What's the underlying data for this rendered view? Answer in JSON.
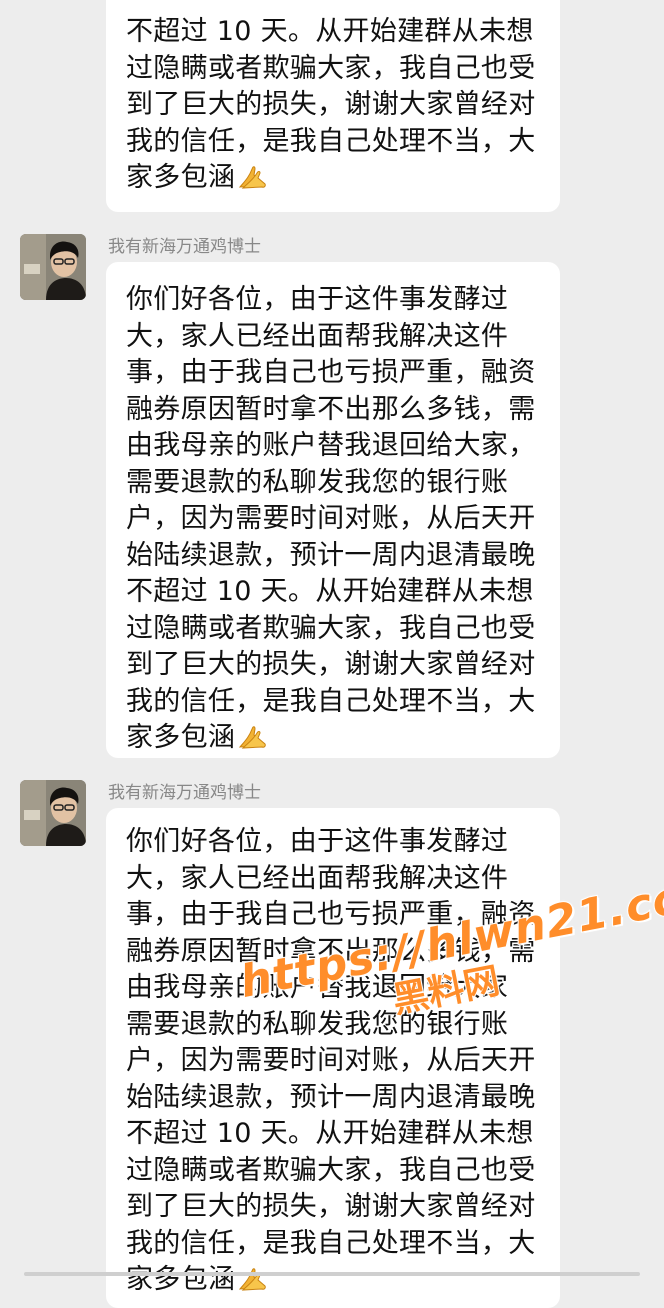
{
  "messages": [
    {
      "sender": "",
      "text": "不超过 10 天。从开始建群从未想\n过隐瞒或者欺骗大家，我自己也受\n到了巨大的损失，谢谢大家曾经对\n我的信任，是我自己处理不当，大\n家多包涵",
      "emoji": "pray-icon"
    },
    {
      "sender": "我有新海万通鸡博士",
      "text": "你们好各位，由于这件事发酵过\n大，家人已经出面帮我解决这件\n事，由于我自己也亏损严重，融资\n融券原因暂时拿不出那么多钱，需\n由我母亲的账户替我退回给大家，\n需要退款的私聊发我您的银行账\n户，因为需要时间对账，从后天开\n始陆续退款，预计一周内退清最晚\n不超过 10 天。从开始建群从未想\n过隐瞒或者欺骗大家，我自己也受\n到了巨大的损失，谢谢大家曾经对\n我的信任，是我自己处理不当，大\n家多包涵",
      "emoji": "pray-icon"
    },
    {
      "sender": "我有新海万通鸡博士",
      "text": "你们好各位，由于这件事发酵过\n大，家人已经出面帮我解决这件\n事，由于我自己也亏损严重，融资\n融券原因暂时拿不出那么多钱，需\n由我母亲的账户替我退回给大家\n需要退款的私聊发我您的银行账\n户，因为需要时间对账，从后天开\n始陆续退款，预计一周内退清最晚\n不超过 10 天。从开始建群从未想\n过隐瞒或者欺骗大家，我自己也受\n到了巨大的损失，谢谢大家曾经对\n我的信任，是我自己处理不当，大\n家多包涵",
      "emoji": "pray-icon"
    }
  ],
  "watermark": {
    "url": "https://hlwn21.com",
    "name": "黑料网"
  },
  "colors": {
    "background": "#ededed",
    "bubble": "#ffffff",
    "text": "#111111",
    "sender": "#888888",
    "watermark": "#ff8d2a"
  }
}
